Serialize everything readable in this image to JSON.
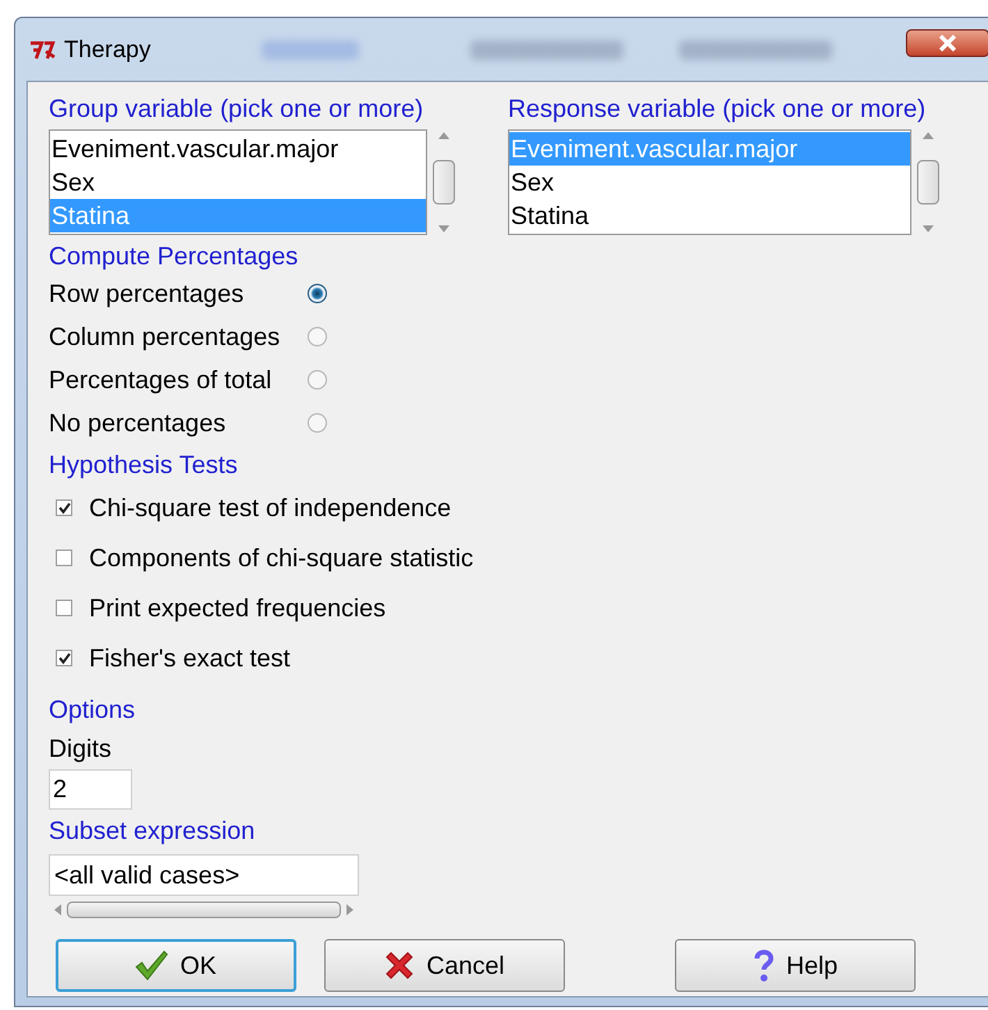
{
  "window": {
    "title": "Therapy"
  },
  "group_variable": {
    "label": "Group variable (pick one or more)",
    "items": [
      {
        "label": "Eveniment.vascular.major",
        "selected": false
      },
      {
        "label": "Sex",
        "selected": false
      },
      {
        "label": "Statina",
        "selected": true
      }
    ]
  },
  "response_variable": {
    "label": "Response variable (pick one or more)",
    "items": [
      {
        "label": "Eveniment.vascular.major",
        "selected": true
      },
      {
        "label": "Sex",
        "selected": false
      },
      {
        "label": "Statina",
        "selected": false
      }
    ]
  },
  "percentages": {
    "label": "Compute Percentages",
    "options": [
      {
        "label": "Row percentages",
        "selected": true
      },
      {
        "label": "Column percentages",
        "selected": false
      },
      {
        "label": "Percentages of total",
        "selected": false
      },
      {
        "label": "No percentages",
        "selected": false
      }
    ]
  },
  "hypothesis_tests": {
    "label": "Hypothesis Tests",
    "options": [
      {
        "label": "Chi-square test of independence",
        "checked": true
      },
      {
        "label": "Components of chi-square statistic",
        "checked": false
      },
      {
        "label": "Print expected frequencies",
        "checked": false
      },
      {
        "label": "Fisher's exact test",
        "checked": true
      }
    ]
  },
  "options": {
    "label": "Options",
    "digits_label": "Digits",
    "digits_value": "2",
    "subset_label": "Subset expression",
    "subset_value": "<all valid cases>"
  },
  "buttons": [
    {
      "kind": "ok",
      "label": "OK"
    },
    {
      "kind": "cancel",
      "label": "Cancel"
    },
    {
      "kind": "help",
      "label": "Help"
    }
  ]
}
